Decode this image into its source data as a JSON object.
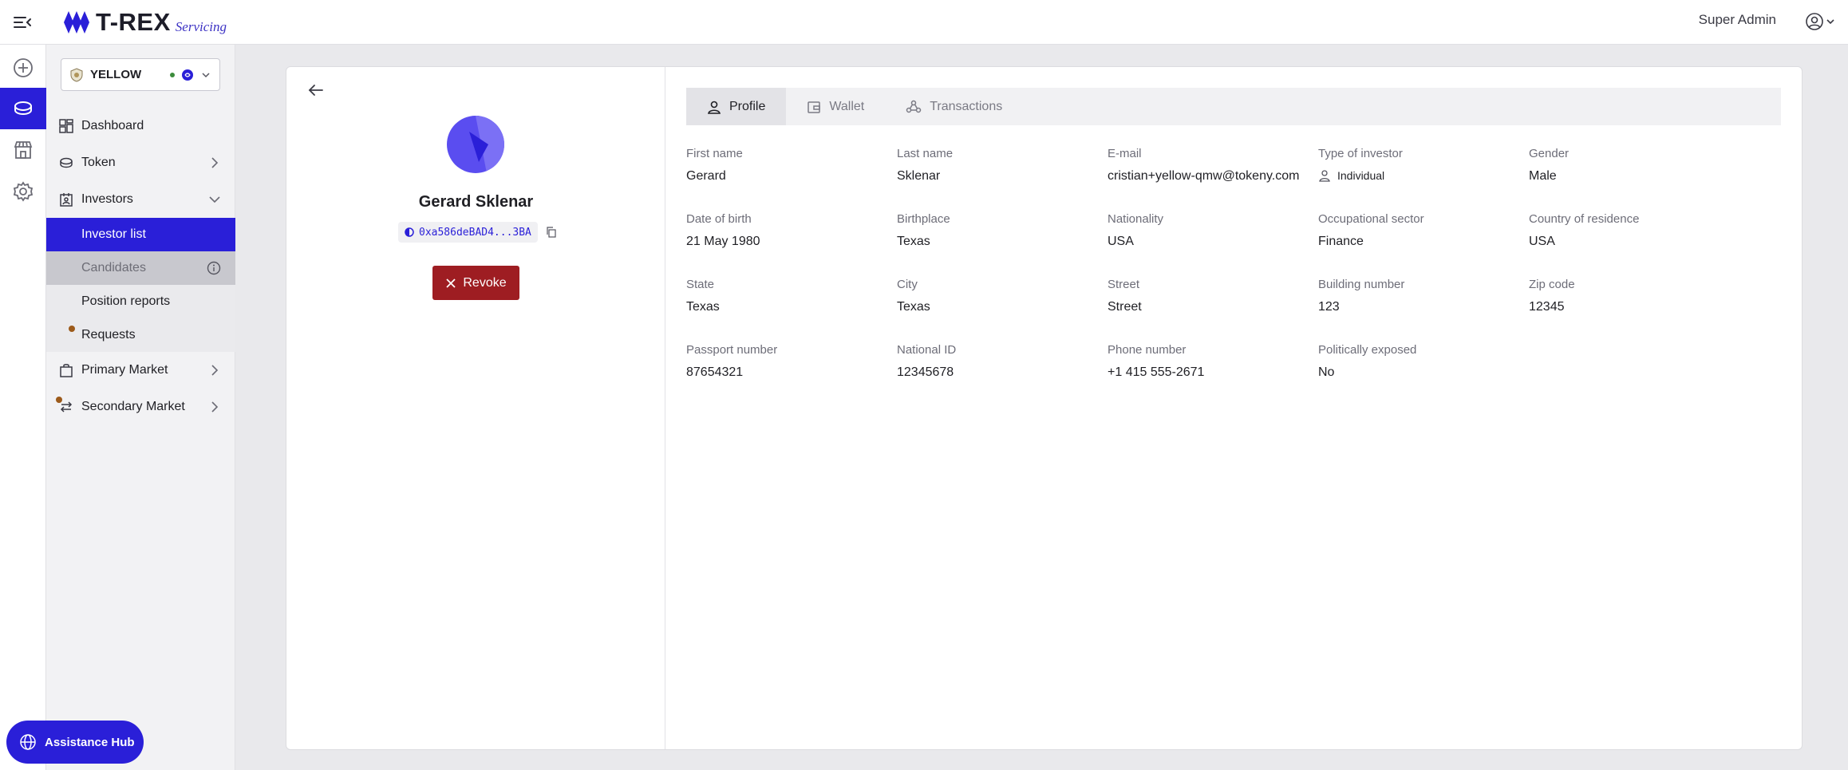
{
  "header": {
    "brand": "T-REX",
    "brand_sub": "Servicing",
    "user_name": "Super Admin"
  },
  "token_selector": {
    "name": "YELLOW"
  },
  "nav": {
    "dashboard": "Dashboard",
    "token": "Token",
    "investors": "Investors",
    "investor_list": "Investor list",
    "candidates": "Candidates",
    "position_reports": "Position reports",
    "requests": "Requests",
    "primary_market": "Primary Market",
    "secondary_market": "Secondary Market"
  },
  "assistance_hub": "Assistance Hub",
  "investor": {
    "name": "Gerard Sklenar",
    "wallet": "0xa586deBAD4...3BA",
    "revoke_label": "Revoke"
  },
  "tabs": [
    {
      "label": "Profile"
    },
    {
      "label": "Wallet"
    },
    {
      "label": "Transactions"
    }
  ],
  "profile_fields": [
    {
      "label": "First name",
      "value": "Gerard"
    },
    {
      "label": "Last name",
      "value": "Sklenar"
    },
    {
      "label": "E-mail",
      "value": "cristian+yellow-qmw@tokeny.com"
    },
    {
      "label": "Type of investor",
      "value": "Individual"
    },
    {
      "label": "Gender",
      "value": "Male"
    },
    {
      "label": "Date of birth",
      "value": "21 May 1980"
    },
    {
      "label": "Birthplace",
      "value": "Texas"
    },
    {
      "label": "Nationality",
      "value": "USA"
    },
    {
      "label": "Occupational sector",
      "value": "Finance"
    },
    {
      "label": "Country of residence",
      "value": "USA"
    },
    {
      "label": "State",
      "value": "Texas"
    },
    {
      "label": "City",
      "value": "Texas"
    },
    {
      "label": "Street",
      "value": "Street"
    },
    {
      "label": "Building number",
      "value": "123"
    },
    {
      "label": "Zip code",
      "value": "12345"
    },
    {
      "label": "Passport number",
      "value": "87654321"
    },
    {
      "label": "National ID",
      "value": "12345678"
    },
    {
      "label": "Phone number",
      "value": "+1 415 555-2671"
    },
    {
      "label": "Politically exposed",
      "value": "No"
    }
  ],
  "colors": {
    "accent": "#2a1fd8",
    "revoke": "#9e1d22",
    "notification_dot": "#9c5a1a"
  }
}
